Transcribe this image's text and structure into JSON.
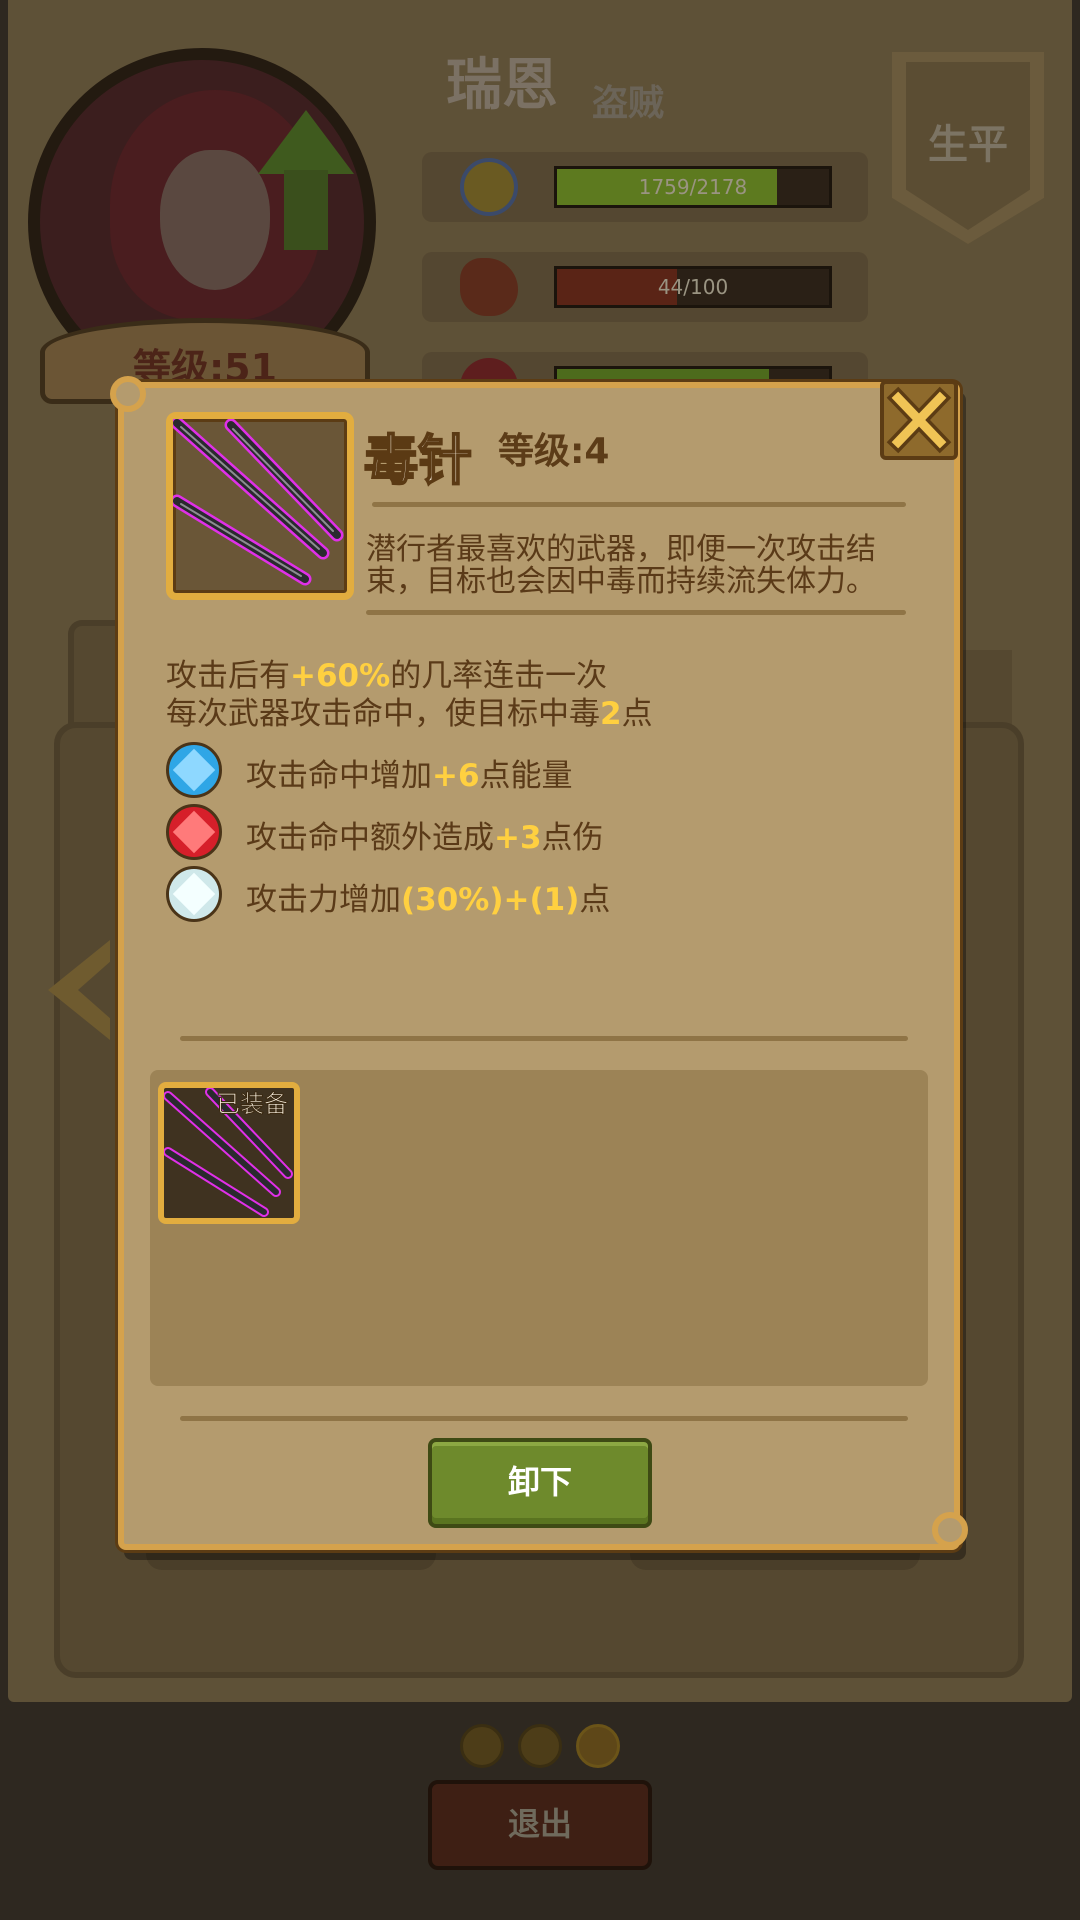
{
  "hero": {
    "name": "瑞恩",
    "class": "盗贼",
    "level_text": "等级:51",
    "career_label": "生平"
  },
  "stats": {
    "experience": {
      "text": "1759/2178",
      "fraction": 0.81,
      "icon": "medal-icon",
      "color": "#5d7a1f"
    },
    "hunger": {
      "text": "44/100",
      "fraction": 0.44,
      "icon": "stomach-icon",
      "color": "#5a2416"
    },
    "health": {
      "fraction": 0.78,
      "icon": "heart-icon",
      "color": "#4d6b1c"
    }
  },
  "pager": {
    "count": 3,
    "active_index": 2
  },
  "bottom": {
    "exit_label": "退出"
  },
  "dialog": {
    "item_name": "毒针",
    "item_level": "等级:4",
    "description": "潜行者最喜欢的武器，即便一次攻击结束，目标也会因中毒而持续流失体力。",
    "effect_1": {
      "before": "攻击后有",
      "value": "+60%",
      "after": "的几率连击一次"
    },
    "effect_2": {
      "before": "每次武器攻击命中，使目标中毒",
      "value": "2",
      "after": "点"
    },
    "gem_bonuses": [
      {
        "gem": "blue-gem-icon",
        "color": "#2fa6e6",
        "before": "攻击命中增加",
        "value": "+6",
        "after": "点能量"
      },
      {
        "gem": "red-gem-icon",
        "color": "#d61f2a",
        "before": "攻击命中额外造成",
        "value": "+3",
        "after": "点伤"
      },
      {
        "gem": "white-gem-icon",
        "color": "#cfe8ea",
        "before": "攻击力增加",
        "value": "(30%)+(1)",
        "after": "点"
      }
    ],
    "equipped_tag": "已装备",
    "unequip_label": "卸下"
  },
  "colors": {
    "accent_gold": "#e2ad3f",
    "highlight": "#ffd040",
    "button_green": "#6e8a2c",
    "parchment": "#b49b6e"
  }
}
